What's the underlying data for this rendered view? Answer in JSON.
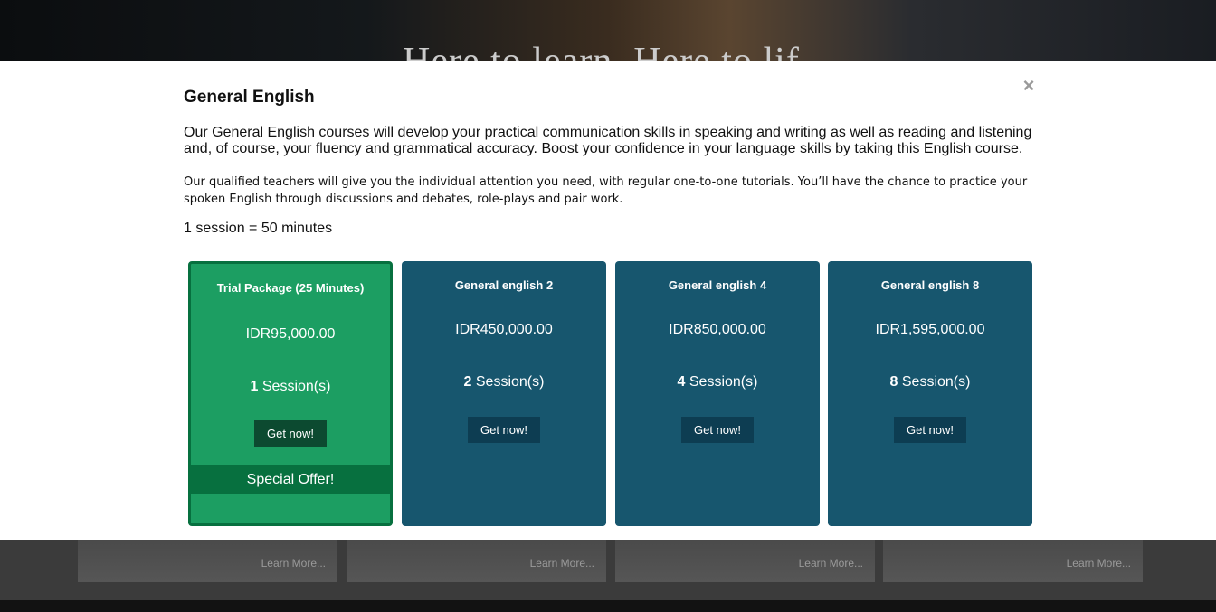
{
  "background": {
    "hero_text": "Here to learn. Here to lif",
    "cards": [
      {
        "learn_more": "Learn More..."
      },
      {
        "learn_more": "Learn More..."
      },
      {
        "learn_more": "Learn More..."
      },
      {
        "learn_more": "Learn More..."
      }
    ]
  },
  "modal": {
    "close_icon": "×",
    "title": "General English",
    "paragraph1": "Our General English courses will develop your practical communication skills in speaking and writing as well as reading and listening and, of course, your fluency and grammatical accuracy. Boost your confidence in your language skills by taking this English course.",
    "paragraph2": "Our qualified teachers will give you the individual attention you need, with regular one-to-one tutorials. You’ll have the chance to practice your spoken English through discussions and debates, role-plays and pair work.",
    "session_note": "1 session = 50 minutes",
    "packages": [
      {
        "name": "Trial Package (25 Minutes)",
        "price": "IDR95,000.00",
        "sessions": "1",
        "sessions_suffix": " Session(s)",
        "button": "Get now!",
        "offer": "Special Offer!"
      },
      {
        "name": "General english 2",
        "price": "IDR450,000.00",
        "sessions": "2",
        "sessions_suffix": " Session(s)",
        "button": "Get now!"
      },
      {
        "name": "General english 4",
        "price": "IDR850,000.00",
        "sessions": "4",
        "sessions_suffix": " Session(s)",
        "button": "Get now!"
      },
      {
        "name": "General english 8",
        "price": "IDR1,595,000.00",
        "sessions": "8",
        "sessions_suffix": " Session(s)",
        "button": "Get now!"
      }
    ]
  },
  "colors": {
    "trial_green": "#1c9e62",
    "trial_border": "#07703f",
    "package_blue": "#17566e",
    "button_dark": "#0d3d52"
  }
}
